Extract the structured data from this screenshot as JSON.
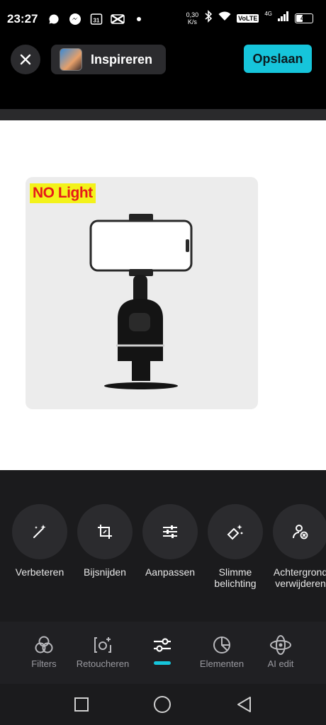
{
  "status_bar": {
    "time": "23:27",
    "net_speed_value": "0,30",
    "net_speed_unit": "K/s",
    "volte": "VoLTE",
    "network": "4G",
    "battery": "41",
    "battery_level": 0.41,
    "icons": [
      "chat-bubble-icon",
      "messenger-icon",
      "calendar-icon",
      "capcut-icon",
      "dot-icon"
    ],
    "calendar_day": "31"
  },
  "header": {
    "inspire_label": "Inspireren",
    "save_label": "Opslaan"
  },
  "photo": {
    "badge": "NO Light"
  },
  "tools": [
    {
      "label": "Verbeteren",
      "icon": "magic-wand-icon"
    },
    {
      "label": "Bijsnijden",
      "icon": "crop-icon"
    },
    {
      "label": "Aanpassen",
      "icon": "sliders-icon"
    },
    {
      "label": "Slimme belichting",
      "icon": "smart-light-icon"
    },
    {
      "label": "Achtergrond verwijderen",
      "icon": "remove-background-icon"
    }
  ],
  "bottom_nav": [
    {
      "label": "Filters",
      "icon": "filters-icon"
    },
    {
      "label": "Retoucheren",
      "icon": "retouch-icon"
    },
    {
      "label": "",
      "icon": "adjust-icon",
      "active": true
    },
    {
      "label": "Elementen",
      "icon": "elements-icon"
    },
    {
      "label": "AI edit",
      "icon": "ai-edit-icon"
    }
  ],
  "colors": {
    "accent": "#16c5db",
    "badge_background": "#f3f21a",
    "badge_text": "#e61a1a"
  }
}
